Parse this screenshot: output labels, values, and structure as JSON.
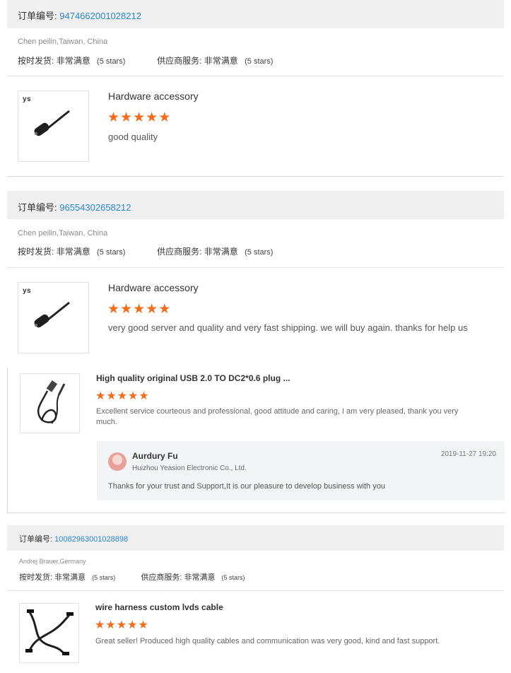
{
  "order_label": "订单编号:",
  "reviews": [
    {
      "order_no": "9474662001028212",
      "buyer": "Chen peilin,Taiwan, China",
      "ship_label": "按时发货:",
      "ship_value": "非常满意",
      "ship_stars": "(5 stars)",
      "supplier_label": "供应商服务:",
      "supplier_value": "非常满意",
      "supplier_stars": "(5 stars)",
      "product_title": "Hardware accessory",
      "thumb_logo": "ys",
      "review_text": "good quality"
    },
    {
      "order_no": "96554302658212",
      "buyer": "Chen peilin,Taiwan, China",
      "ship_label": "按时发货:",
      "ship_value": "非常满意",
      "ship_stars": "(5 stars)",
      "supplier_label": "供应商服务:",
      "supplier_value": "非常满意",
      "supplier_stars": "(5 stars)",
      "product_title": "Hardware accessory",
      "thumb_logo": "ys",
      "review_text": "very good server and quality and  very fast shipping. we will buy again. thanks for help us"
    },
    {
      "product_title": "High quality original USB 2.0 TO DC2*0.6 plug ...",
      "review_text": "Excellent service courteous and professional, good attitude and caring, I am very pleased, thank you very much.",
      "reply": {
        "name": "Aurdury Fu",
        "company": "Huizhou Yeasion Electronic Co., Ltd.",
        "time": "2019-11-27 19:20",
        "message": "Thanks for your trust and Support,It is our pleasure to develop business with you"
      }
    },
    {
      "order_no": "10082963001028898",
      "buyer": "Andrej Brauer,Germany",
      "ship_label": "按时发货:",
      "ship_value": "非常满意",
      "ship_stars": "(5 stars)",
      "supplier_label": "供应商服务:",
      "supplier_value": "非常满意",
      "supplier_stars": "(5 stars)",
      "product_title": "wire harness custom lvds cable",
      "review_text": "Great seller! Produced high quality cables and communication was very good, kind and fast support."
    }
  ],
  "star_glyph": "★",
  "colors": {
    "accent": "#2a86cf",
    "stars": "#f56b1a",
    "header_bg": "#efefef"
  }
}
